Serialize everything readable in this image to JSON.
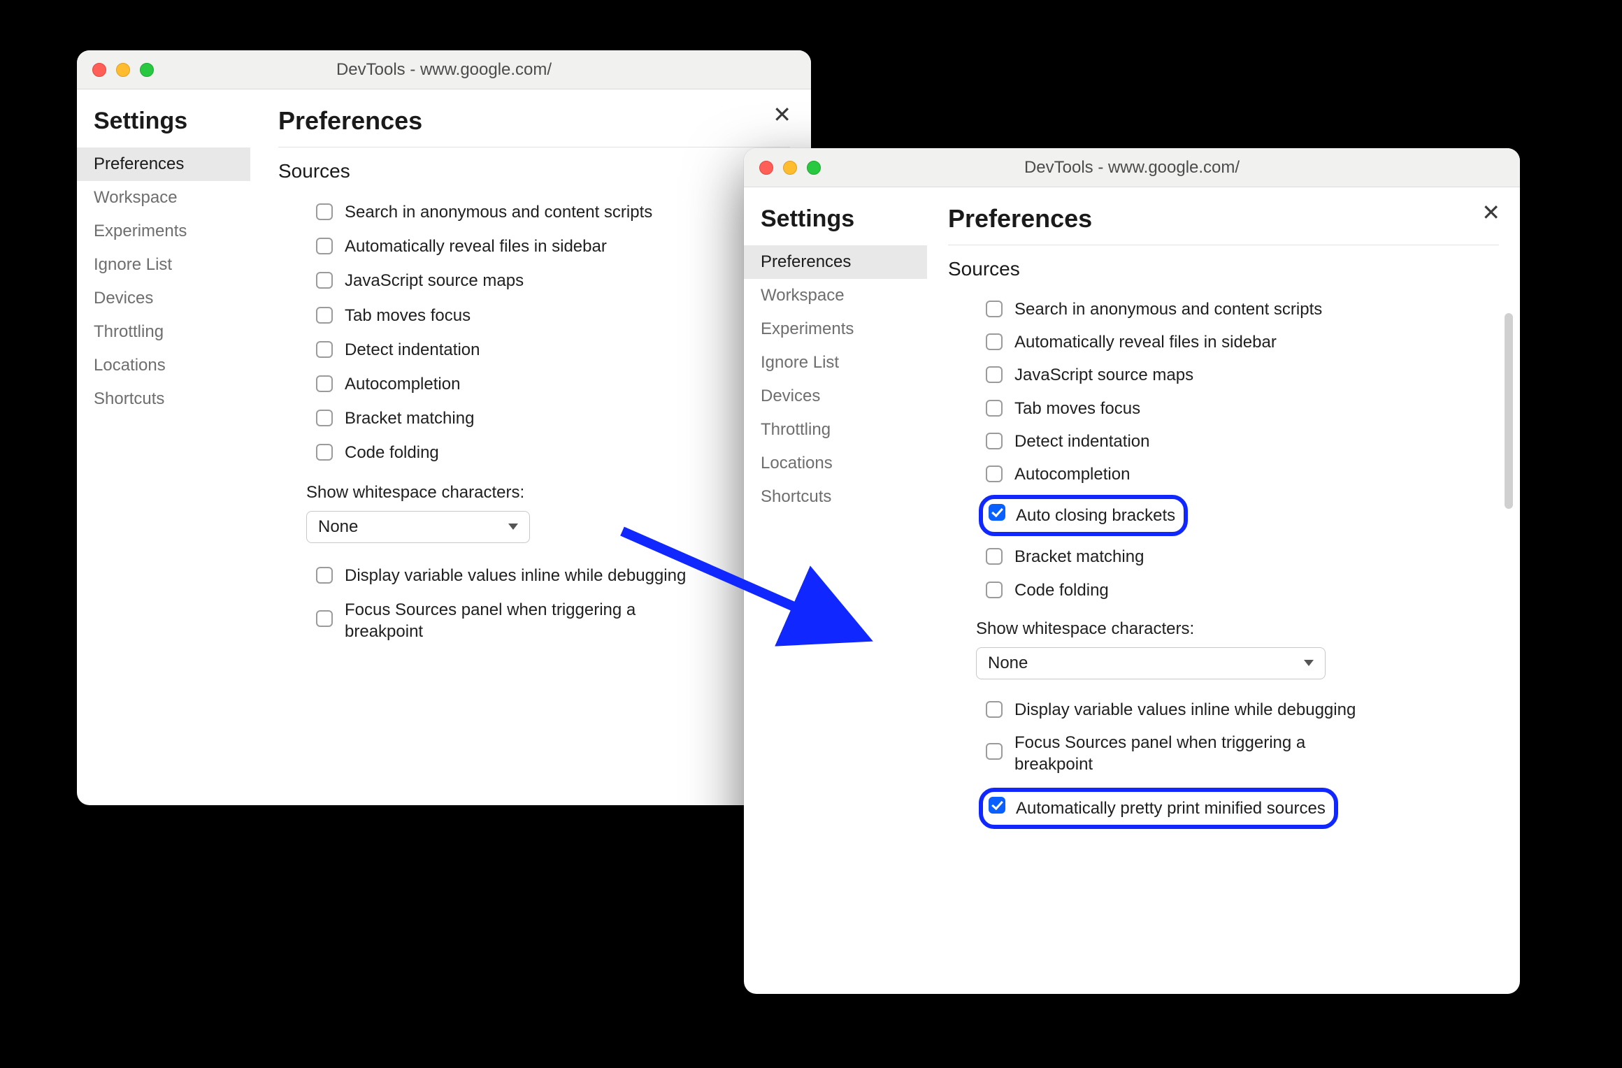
{
  "windows": {
    "left": {
      "title": "DevTools - www.google.com/",
      "settings_heading": "Settings",
      "main_heading": "Preferences",
      "nav": [
        "Preferences",
        "Workspace",
        "Experiments",
        "Ignore List",
        "Devices",
        "Throttling",
        "Locations",
        "Shortcuts"
      ],
      "section": "Sources",
      "options": [
        {
          "label": "Search in anonymous and content scripts",
          "checked": false
        },
        {
          "label": "Automatically reveal files in sidebar",
          "checked": false
        },
        {
          "label": "JavaScript source maps",
          "checked": false
        },
        {
          "label": "Tab moves focus",
          "checked": false
        },
        {
          "label": "Detect indentation",
          "checked": false
        },
        {
          "label": "Autocompletion",
          "checked": false
        },
        {
          "label": "Bracket matching",
          "checked": false
        },
        {
          "label": "Code folding",
          "checked": false
        }
      ],
      "whitespace_label": "Show whitespace characters:",
      "whitespace_value": "None",
      "post_options": [
        {
          "label": "Display variable values inline while debugging",
          "checked": false
        },
        {
          "label": "Focus Sources panel when triggering a breakpoint",
          "checked": false
        }
      ]
    },
    "right": {
      "title": "DevTools - www.google.com/",
      "settings_heading": "Settings",
      "main_heading": "Preferences",
      "nav": [
        "Preferences",
        "Workspace",
        "Experiments",
        "Ignore List",
        "Devices",
        "Throttling",
        "Locations",
        "Shortcuts"
      ],
      "section": "Sources",
      "options": [
        {
          "label": "Search in anonymous and content scripts",
          "checked": false
        },
        {
          "label": "Automatically reveal files in sidebar",
          "checked": false
        },
        {
          "label": "JavaScript source maps",
          "checked": false
        },
        {
          "label": "Tab moves focus",
          "checked": false
        },
        {
          "label": "Detect indentation",
          "checked": false
        },
        {
          "label": "Autocompletion",
          "checked": false
        },
        {
          "label": "Auto closing brackets",
          "checked": true,
          "highlight": true
        },
        {
          "label": "Bracket matching",
          "checked": false
        },
        {
          "label": "Code folding",
          "checked": false
        }
      ],
      "whitespace_label": "Show whitespace characters:",
      "whitespace_value": "None",
      "post_options": [
        {
          "label": "Display variable values inline while debugging",
          "checked": false
        },
        {
          "label": "Focus Sources panel when triggering a breakpoint",
          "checked": false
        },
        {
          "label": "Automatically pretty print minified sources",
          "checked": true,
          "highlight": true
        }
      ]
    }
  },
  "colors": {
    "accent": "#0a60ff",
    "highlight_border": "#1028ff"
  }
}
